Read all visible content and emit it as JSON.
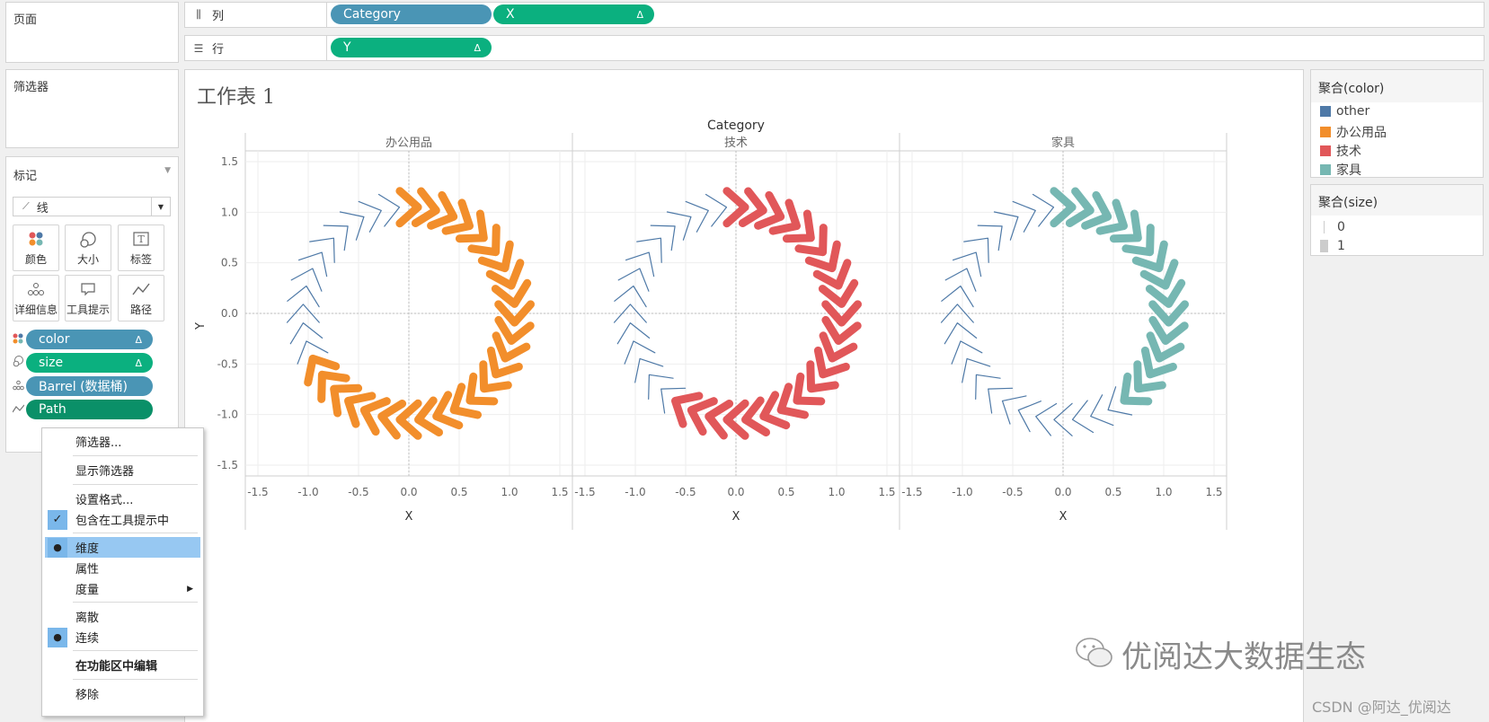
{
  "left": {
    "pages_title": "页面",
    "filters_title": "筛选器",
    "marks": {
      "title": "标记",
      "mark_type": "线",
      "buttons": [
        "颜色",
        "大小",
        "标签",
        "详细信息",
        "工具提示",
        "路径"
      ],
      "fields": [
        {
          "name": "color",
          "delta": "Δ",
          "icon": "color-icon"
        },
        {
          "name": "size",
          "delta": "Δ",
          "icon": "size-icon"
        },
        {
          "name": "Barrel (数据桶)",
          "delta": "",
          "icon": "detail-icon"
        },
        {
          "name": "Path",
          "delta": "",
          "icon": "path-icon"
        }
      ]
    }
  },
  "shelves": {
    "columns_label": "列",
    "rows_label": "行",
    "columns_pills": [
      {
        "label": "Category",
        "delta": ""
      },
      {
        "label": "X",
        "delta": "Δ"
      }
    ],
    "rows_pills": [
      {
        "label": "Y",
        "delta": "Δ"
      }
    ]
  },
  "context_menu": {
    "items": [
      {
        "label": "筛选器...",
        "check": "",
        "selected": false,
        "bold": false
      },
      {
        "label": "显示筛选器",
        "check": "",
        "selected": false,
        "bold": false
      },
      {
        "label": "设置格式...",
        "check": "",
        "selected": false,
        "bold": false
      },
      {
        "label": "包含在工具提示中",
        "check": "✓",
        "selected": false,
        "bold": false
      },
      {
        "label": "维度",
        "check": "●",
        "selected": true,
        "bold": false
      },
      {
        "label": "属性",
        "check": "",
        "selected": false,
        "bold": false
      },
      {
        "label": "度量",
        "check": "",
        "selected": false,
        "bold": false,
        "submenu": "▶"
      },
      {
        "label": "离散",
        "check": "",
        "selected": false,
        "bold": false
      },
      {
        "label": "连续",
        "check": "●",
        "selected": false,
        "bold": false
      },
      {
        "label": "在功能区中编辑",
        "check": "",
        "selected": false,
        "bold": true
      },
      {
        "label": "移除",
        "check": "",
        "selected": false,
        "bold": false
      }
    ]
  },
  "worksheet": {
    "title": "工作表 1",
    "column_header": "Category"
  },
  "legend_color": {
    "title": "聚合(color)",
    "items": [
      {
        "label": "other",
        "color": "#4e79a7"
      },
      {
        "label": "办公用品",
        "color": "#f28e2b"
      },
      {
        "label": "技术",
        "color": "#e15759"
      },
      {
        "label": "家具",
        "color": "#76b7b2"
      }
    ]
  },
  "legend_size": {
    "title": "聚合(size)",
    "items": [
      {
        "label": "0"
      },
      {
        "label": "1"
      }
    ]
  },
  "watermark": {
    "brand": "优阅达大数据生态",
    "credit": "CSDN @阿达_优阅达"
  },
  "chart_data": {
    "type": "line",
    "xlabel": "X",
    "ylabel": "Y",
    "column_field": "Category",
    "xlim": [
      -1.5,
      1.5
    ],
    "ylim": [
      -1.5,
      1.5
    ],
    "x_ticks": [
      "-1.5",
      "-1.0",
      "-0.5",
      "0.0",
      "0.5",
      "1.0",
      "1.5"
    ],
    "y_ticks": [
      "1.5",
      "1.0",
      "0.5",
      "0.0",
      "-0.5",
      "-1.0",
      "-1.5"
    ],
    "grid": true,
    "panels": [
      {
        "name": "办公用品",
        "color": "#f28e2b",
        "other_color": "#4e79a7",
        "arrows": 36,
        "highlighted_from_angle_deg": 90,
        "highlighted_to_angle_deg": -155
      },
      {
        "name": "技术",
        "color": "#e15759",
        "other_color": "#4e79a7",
        "arrows": 36,
        "highlighted_from_angle_deg": 90,
        "highlighted_to_angle_deg": -120
      },
      {
        "name": "家具",
        "color": "#76b7b2",
        "other_color": "#4e79a7",
        "arrows": 36,
        "highlighted_from_angle_deg": 90,
        "highlighted_to_angle_deg": -55
      }
    ]
  }
}
